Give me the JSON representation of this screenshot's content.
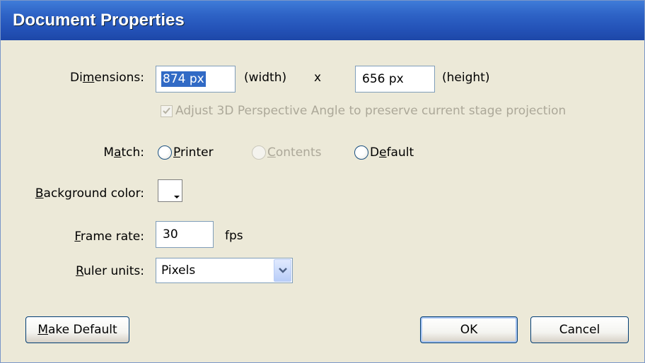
{
  "window": {
    "title": "Document Properties"
  },
  "dimensions": {
    "label_pre": "Di",
    "label_acc": "m",
    "label_post": "ensions:",
    "width_value": "874 px",
    "width_label": "(width)",
    "separator": "x",
    "height_value": "656 px",
    "height_label": "(height)",
    "perspective_checkbox_label": "Adjust 3D Perspective Angle to preserve current stage projection",
    "perspective_checked": true
  },
  "match": {
    "label_pre": "M",
    "label_acc": "a",
    "label_post": "tch:",
    "options": [
      {
        "pre": "",
        "acc": "P",
        "post": "rinter",
        "enabled": true
      },
      {
        "pre": "",
        "acc": "C",
        "post": "ontents",
        "enabled": false
      },
      {
        "pre": "D",
        "acc": "e",
        "post": "fault",
        "enabled": true
      }
    ]
  },
  "background": {
    "label_pre": "",
    "label_acc": "B",
    "label_post": "ackground color:",
    "color": "#ffffff"
  },
  "frame_rate": {
    "label_pre": "",
    "label_acc": "F",
    "label_post": "rame rate:",
    "value": "30",
    "unit": "fps"
  },
  "ruler_units": {
    "label_pre": "",
    "label_acc": "R",
    "label_post": "uler units:",
    "selected": "Pixels"
  },
  "buttons": {
    "make_default_pre": "",
    "make_default_acc": "M",
    "make_default_post": "ake Default",
    "ok": "OK",
    "cancel": "Cancel"
  },
  "colors": {
    "title_bar": "#2453b8",
    "dialog_bg": "#ece9d8",
    "selection": "#316ac5"
  }
}
